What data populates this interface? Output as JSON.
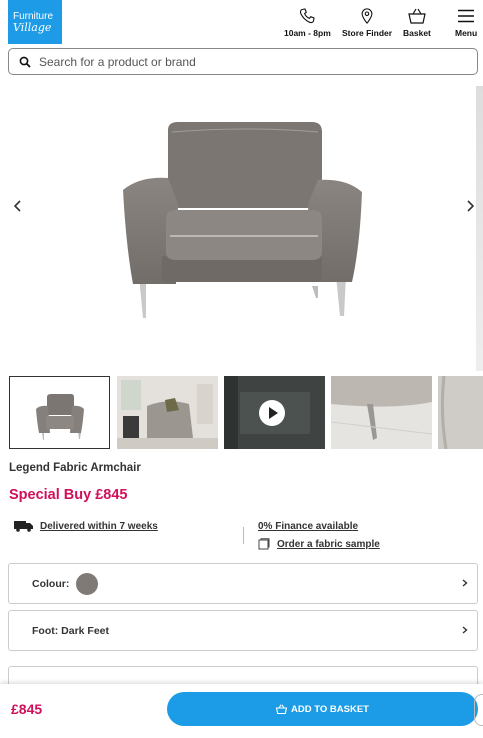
{
  "header": {
    "logo_line1": "Furniture",
    "logo_line2": "Village",
    "hours_label": "10am - 8pm",
    "store_finder_label": "Store Finder",
    "basket_label": "Basket",
    "menu_label": "Menu"
  },
  "search": {
    "placeholder": "Search for a product or brand"
  },
  "product": {
    "title": "Legend Fabric Armchair",
    "price_label": "Special Buy £845",
    "delivery": "Delivered within 7 weeks",
    "finance": "0% Finance available",
    "sample": "Order a fabric sample",
    "colour_label": "Colour:",
    "foot_label": "Foot: Dark Feet"
  },
  "sticky": {
    "price": "£845",
    "add_label": "ADD TO BASKET"
  },
  "colors": {
    "brand_blue": "#1e9be6",
    "price_pink": "#d0105a",
    "swatch": "#807a76"
  }
}
